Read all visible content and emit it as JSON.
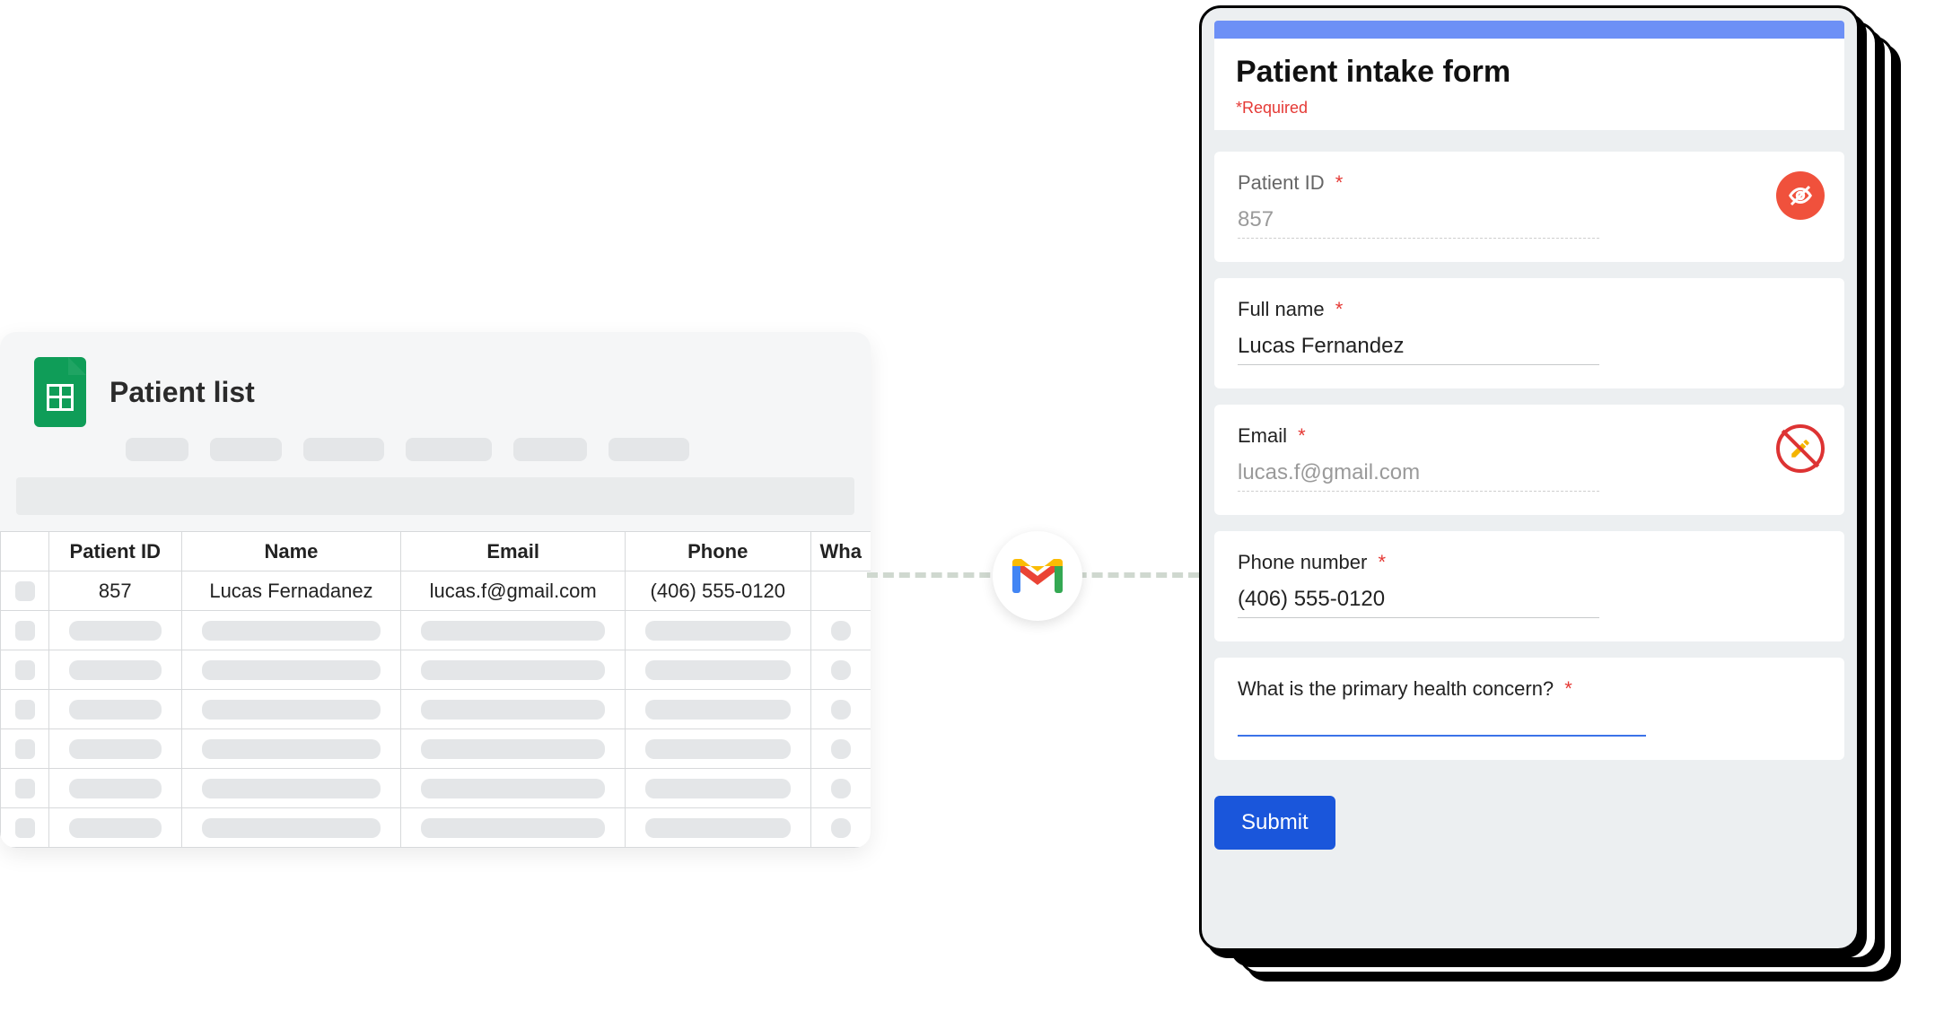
{
  "spreadsheet": {
    "title": "Patient list",
    "columns": [
      "Patient ID",
      "Name",
      "Email",
      "Phone",
      "Wha"
    ],
    "row1": {
      "patient_id": "857",
      "name": "Lucas Fernadanez",
      "email": "lucas.f@gmail.com",
      "phone": "(406) 555-0120"
    }
  },
  "connector": {
    "via": "Gmail"
  },
  "form": {
    "title": "Patient intake form",
    "required_note": "*Required",
    "required_marker": "*",
    "questions": {
      "patient_id": {
        "label": "Patient ID",
        "value": "857",
        "hidden": true
      },
      "full_name": {
        "label": "Full name",
        "value": "Lucas Fernandez"
      },
      "email": {
        "label": "Email",
        "value": "lucas.f@gmail.com",
        "readonly": true
      },
      "phone": {
        "label": "Phone number",
        "value": "(406) 555-0120"
      },
      "concern": {
        "label": "What is the primary health concern?",
        "value": ""
      }
    },
    "submit_label": "Submit"
  }
}
